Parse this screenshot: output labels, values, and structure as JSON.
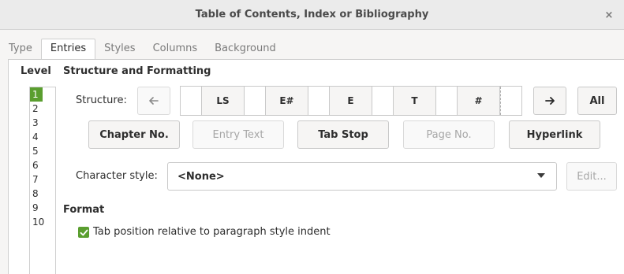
{
  "window": {
    "title": "Table of Contents, Index or Bibliography",
    "close_glyph": "×"
  },
  "tabs": [
    {
      "label": "Type",
      "active": false
    },
    {
      "label": "Entries",
      "active": true
    },
    {
      "label": "Styles",
      "active": false
    },
    {
      "label": "Columns",
      "active": false
    },
    {
      "label": "Background",
      "active": false
    }
  ],
  "level": {
    "heading": "Level",
    "items": [
      "1",
      "2",
      "3",
      "4",
      "5",
      "6",
      "7",
      "8",
      "9",
      "10"
    ],
    "selected": "1"
  },
  "structure_formatting": {
    "heading": "Structure and Formatting",
    "structure_label": "Structure:",
    "tokens": [
      "LS",
      "E#",
      "E",
      "T",
      "#"
    ],
    "all_label": "All"
  },
  "insert_buttons": {
    "chapter_no": "Chapter No.",
    "entry_text": "Entry Text",
    "tab_stop": "Tab Stop",
    "page_no": "Page No.",
    "hyperlink": "Hyperlink"
  },
  "character_style": {
    "label": "Character style:",
    "value": "<None>",
    "edit_label": "Edit..."
  },
  "format": {
    "heading": "Format",
    "tab_position_label": "Tab position relative to paragraph style indent",
    "tab_position_checked": true
  },
  "colors": {
    "accent": "#5a9e2f",
    "dialog_bg": "#f6f5f4",
    "panel_bg": "#ffffff"
  }
}
